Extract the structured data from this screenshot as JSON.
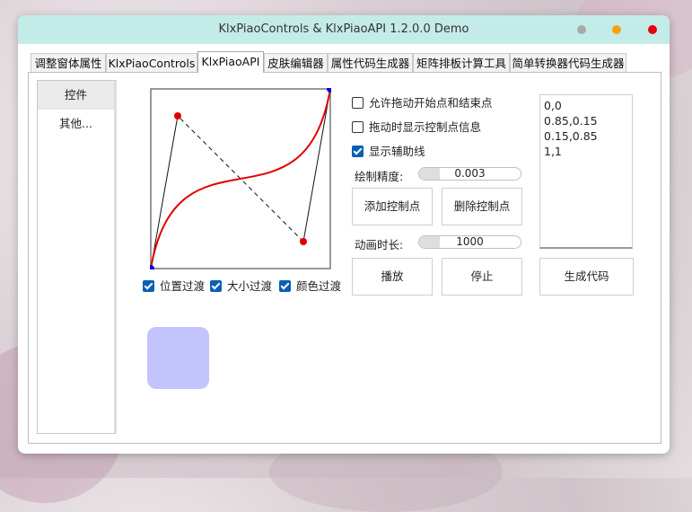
{
  "window": {
    "title": "KlxPiaoControls & KlxPiaoAPI 1.2.0.0 Demo"
  },
  "colors": {
    "titlebar": "#c3ece8",
    "min": "#a9a9a9",
    "max": "#f6a30a",
    "close": "#e6000f",
    "accent": "#0a5fb4",
    "curve": "#e00000",
    "endpoint": "#0000e6",
    "control_point": "#e00000",
    "preview": "#c3c3fe"
  },
  "tabs": [
    {
      "label": "调整窗体属性",
      "active": false
    },
    {
      "label": "KlxPiaoControls",
      "active": false
    },
    {
      "label": "KlxPiaoAPI",
      "active": true
    },
    {
      "label": "皮肤编辑器",
      "active": false
    },
    {
      "label": "属性代码生成器",
      "active": false
    },
    {
      "label": "矩阵排板计算工具",
      "active": false
    },
    {
      "label": "简单转换器代码生成器",
      "active": false
    }
  ],
  "sidebar": {
    "items": [
      {
        "label": "控件",
        "active": true
      },
      {
        "label": "其他...",
        "active": false
      }
    ]
  },
  "bezier": {
    "points": [
      [
        0,
        0
      ],
      [
        0.85,
        0.15
      ],
      [
        0.15,
        0.85
      ],
      [
        1,
        1
      ]
    ],
    "checks": [
      {
        "label": "位置过渡",
        "checked": true
      },
      {
        "label": "大小过渡",
        "checked": true
      },
      {
        "label": "颜色过渡",
        "checked": true
      }
    ]
  },
  "options": [
    {
      "label": "允许拖动开始点和结束点",
      "checked": false
    },
    {
      "label": "拖动时显示控制点信息",
      "checked": false
    },
    {
      "label": "显示辅助线",
      "checked": true
    }
  ],
  "precision": {
    "label": "绘制精度:",
    "value": "0.003",
    "level": 0.2
  },
  "buttons": {
    "add": "添加控制点",
    "remove": "删除控制点",
    "play": "播放",
    "stop": "停止",
    "generate": "生成代码"
  },
  "duration": {
    "label": "动画时长:",
    "value": "1000",
    "level": 0.2
  },
  "points_text": [
    "0,0",
    "0.85,0.15",
    "0.15,0.85",
    "1,1"
  ]
}
